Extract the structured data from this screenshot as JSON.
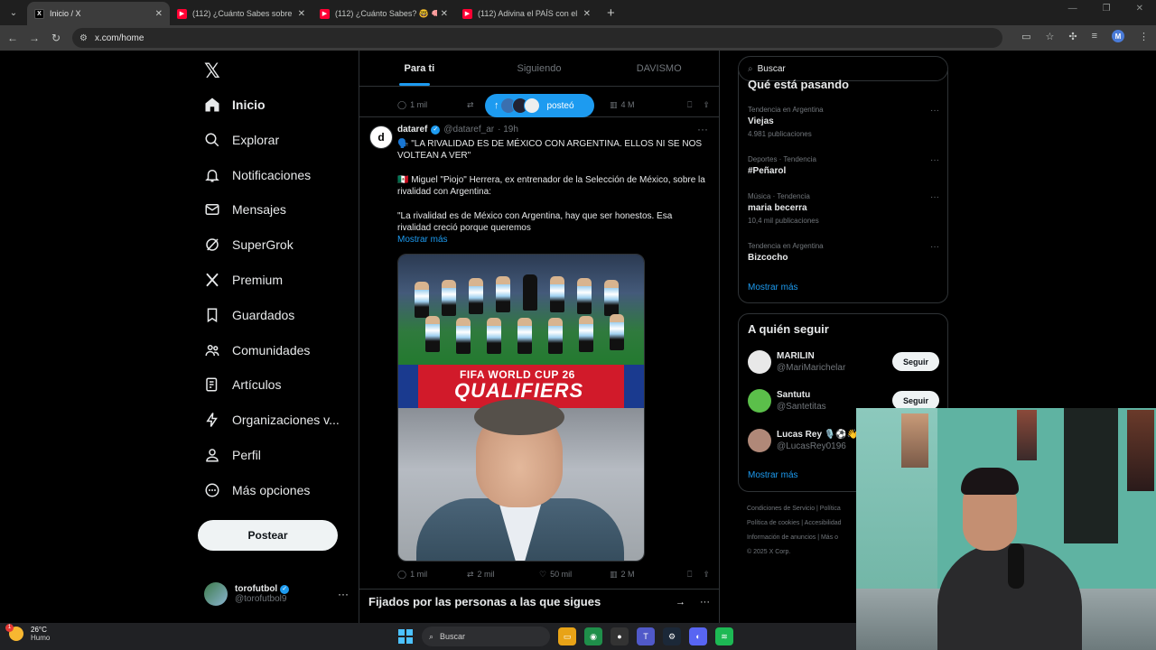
{
  "browser": {
    "tabs": [
      {
        "title": "Inicio / X",
        "favicon": "x-favicon",
        "active": true
      },
      {
        "title": "(112) ¿Cuánto Sabes sobre la Se",
        "favicon": "youtube-favicon",
        "active": false
      },
      {
        "title": "(112) ¿Cuánto Sabes? 🤓 🧠 Pr",
        "favicon": "youtube-favicon",
        "active": false
      },
      {
        "title": "(112) Adivina el PAÍS con el Nor",
        "favicon": "youtube-favicon",
        "active": false
      }
    ],
    "new_tab_glyph": "+",
    "url": "x.com/home",
    "profile_initial": "M"
  },
  "sidebar": {
    "logo": "𝕏",
    "items": [
      {
        "label": "Inicio",
        "icon": "home-icon",
        "active": true
      },
      {
        "label": "Explorar",
        "icon": "search-icon"
      },
      {
        "label": "Notificaciones",
        "icon": "bell-icon"
      },
      {
        "label": "Mensajes",
        "icon": "mail-icon"
      },
      {
        "label": "SuperGrok",
        "icon": "grok-icon"
      },
      {
        "label": "Premium",
        "icon": "x-premium-icon"
      },
      {
        "label": "Guardados",
        "icon": "bookmark-icon"
      },
      {
        "label": "Comunidades",
        "icon": "communities-icon"
      },
      {
        "label": "Artículos",
        "icon": "articles-icon"
      },
      {
        "label": "Organizaciones v...",
        "icon": "lightning-icon"
      },
      {
        "label": "Perfil",
        "icon": "person-icon"
      },
      {
        "label": "Más opciones",
        "icon": "more-circle-icon"
      }
    ],
    "post_button": "Postear",
    "account": {
      "name": "torofutbol",
      "handle": "@torofutbol9"
    }
  },
  "feed": {
    "tabs": [
      "Para ti",
      "Siguiendo",
      "DAVISMO"
    ],
    "prev_actions": {
      "replies": "1 mil",
      "views": "4 M"
    },
    "new_posts_pill": "posteó",
    "tweet": {
      "name": "dataref",
      "handle": "@dataref_ar",
      "time": "· 19h",
      "avatar_letter": "d",
      "line1": "🗣️ \"LA RIVALIDAD ES DE MÉXICO CON ARGENTINA. ELLOS NI SE NOS VOLTEAN A VER\"",
      "line2": "🇲🇽 Miguel \"Piojo\" Herrera, ex entrenador de la Selección de México, sobre la rivalidad con Argentina:",
      "line3": "\"La rivalidad es de México con Argentina, hay que ser honestos. Esa rivalidad creció porque queremos",
      "show_more": "Mostrar más",
      "media_banner_top": "FIFA WORLD CUP 26",
      "media_banner_main": "QUALIFIERS",
      "replies": "1 mil",
      "reposts": "2 mil",
      "likes": "50 mil",
      "views": "2 M"
    },
    "pinned_section": "Fijados por las personas a las que sigues"
  },
  "right": {
    "search_placeholder": "Buscar",
    "trends_title": "Qué está pasando",
    "trends": [
      {
        "context": "Tendencia en Argentina",
        "name": "Viejas",
        "count": "4.981 publicaciones"
      },
      {
        "context": "Deportes · Tendencia",
        "name": "#Peñarol",
        "count": ""
      },
      {
        "context": "Música · Tendencia",
        "name": "maria becerra",
        "count": "10,4 mil publicaciones"
      },
      {
        "context": "Tendencia en Argentina",
        "name": "Bizcocho",
        "count": ""
      }
    ],
    "trends_more": "Mostrar más",
    "follow_title": "A quién seguir",
    "follow": [
      {
        "name": "MARILIN",
        "handle": "@MariMarichelar",
        "button": "Seguir"
      },
      {
        "name": "Santutu",
        "handle": "@Santetitas",
        "button": "Seguir"
      },
      {
        "name": "Lucas Rey 🎙️⚽👋",
        "handle": "@LucasRey0196",
        "button": ""
      }
    ],
    "follow_more": "Mostrar más",
    "footer": [
      "Condiciones de Servicio | Política",
      "Política de cookies | Accesibilidad",
      "Información de anuncios | Más o",
      "© 2025 X Corp."
    ]
  },
  "taskbar": {
    "temperature": "26°C",
    "condition": "Humo",
    "notification_count": "1",
    "search": "Buscar"
  },
  "colors": {
    "accent": "#1d9bf0",
    "background": "#000000",
    "border": "#2f3336",
    "muted": "#71767b"
  }
}
